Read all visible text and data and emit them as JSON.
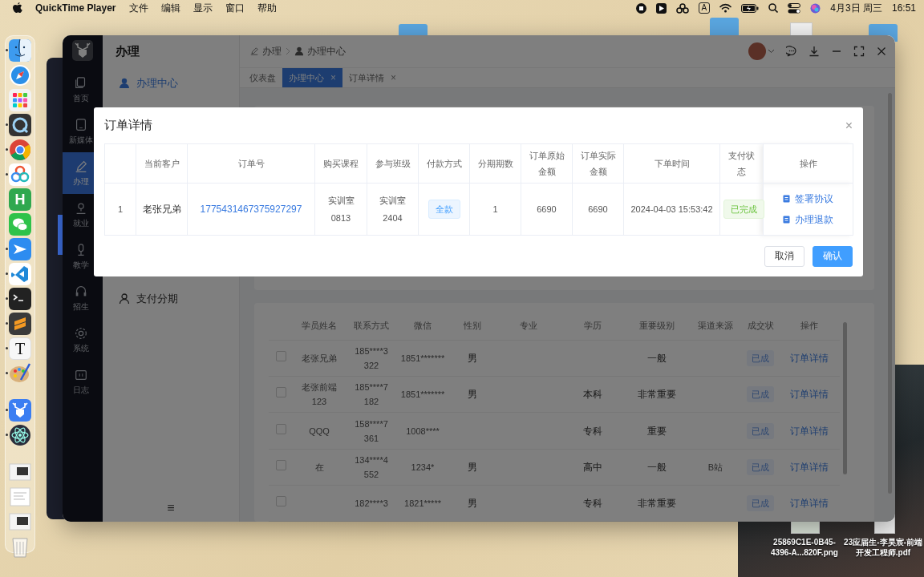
{
  "menubar": {
    "app_name": "QuickTime Player",
    "menus": [
      "文件",
      "编辑",
      "显示",
      "窗口",
      "帮助"
    ],
    "input_method": "A",
    "date": "4月3日 周三",
    "time": "16:51"
  },
  "dock": {
    "apps": [
      {
        "kind": "finder",
        "running": true
      },
      {
        "kind": "safari",
        "running": false
      },
      {
        "kind": "launchpad",
        "running": false
      },
      {
        "kind": "quicktime",
        "running": true
      },
      {
        "kind": "chrome",
        "running": true
      },
      {
        "kind": "cloud",
        "running": true
      },
      {
        "kind": "letter",
        "glyph": "H",
        "running": false
      },
      {
        "kind": "chat",
        "running": false
      },
      {
        "kind": "bird",
        "running": true
      },
      {
        "kind": "code",
        "running": true
      },
      {
        "kind": "terminal",
        "running": true
      },
      {
        "kind": "ribbon",
        "running": true
      },
      {
        "kind": "letter_light",
        "glyph": "T",
        "running": true
      },
      {
        "kind": "palette",
        "running": true
      },
      {
        "kind": "deer",
        "running": true
      },
      {
        "kind": "atom",
        "running": true
      }
    ],
    "minimized": [
      {
        "kind": "window"
      },
      {
        "kind": "document"
      },
      {
        "kind": "window"
      }
    ]
  },
  "desktop_files": [
    {
      "name": "25869C1E-0B45-4396-A...820F.png"
    },
    {
      "name": "23应届生-李昊宸-前端开发工程师.pdf"
    }
  ],
  "app": {
    "sidebar": [
      {
        "label": "首页",
        "selected": false
      },
      {
        "label": "新媒体",
        "selected": false
      },
      {
        "label": "办理",
        "selected": true
      },
      {
        "label": "就业",
        "selected": false
      },
      {
        "label": "教学",
        "selected": false
      },
      {
        "label": "招生",
        "selected": false
      },
      {
        "label": "系统",
        "selected": false
      },
      {
        "label": "日志",
        "selected": false
      }
    ],
    "module_title": "办理",
    "menu": [
      {
        "label": "办理中心",
        "selected": true
      },
      {
        "label": "支付分期",
        "selected": false
      }
    ],
    "menu_toggle": "≡",
    "breadcrumb": [
      "办理",
      "办理中心"
    ],
    "tabs": [
      {
        "label": "仪表盘",
        "selected": false,
        "closable": false
      },
      {
        "label": "办理中心",
        "selected": true,
        "closable": true
      },
      {
        "label": "订单详情",
        "selected": false,
        "closable": true
      }
    ],
    "tab_close": "×",
    "students_table": {
      "columns": [
        "学员姓名",
        "联系方式",
        "微信",
        "性别",
        "专业",
        "学历",
        "重要级别",
        "渠道来源",
        "成交状",
        "操作"
      ],
      "rows": [
        {
          "checked": false,
          "cells": [
            "老张兄弟",
            "185****3322",
            "1851*******",
            "男",
            "",
            "",
            "一般",
            "",
            "已成",
            "订单详情"
          ]
        },
        {
          "checked": false,
          "cells": [
            "老张前端123",
            "185****7182",
            "1851*******",
            "男",
            "",
            "本科",
            "非常重要",
            "",
            "已成",
            "订单详情"
          ]
        },
        {
          "checked": false,
          "cells": [
            "QQQ",
            "158****7361",
            "1008****",
            "",
            "",
            "专科",
            "重要",
            "",
            "已成",
            "订单详情"
          ]
        },
        {
          "checked": false,
          "cells": [
            "在",
            "134****4552",
            "1234*",
            "男",
            "",
            "高中",
            "一般",
            "B站",
            "已成",
            "订单详情"
          ]
        },
        {
          "checked": false,
          "cells": [
            "",
            "182****3",
            "1821*****",
            "男",
            "",
            "专科",
            "非常重要",
            "",
            "已成",
            "订单详情"
          ]
        }
      ]
    }
  },
  "dialog": {
    "title": "订单详情",
    "close": "×",
    "columns": [
      "",
      "当前客户",
      "订单号",
      "购买课程",
      "参与班级",
      "付款方式",
      "分期期数",
      "订单原始金额",
      "订单实际金额",
      "下单时间",
      "支付状态",
      "操作"
    ],
    "rows": [
      {
        "index": "1",
        "customer": "老张兄弟",
        "order_no": "1775431467375927297",
        "course": "实训室0813",
        "class": "实训室2404",
        "payment": "全款",
        "installments": "1",
        "original_amount": "6690",
        "actual_amount": "6690",
        "order_time": "2024-04-03 15:53:42",
        "status": "已完成",
        "actions": [
          "签署协议",
          "办理退款"
        ]
      }
    ],
    "buttons": [
      {
        "label": "取消",
        "primary": false
      },
      {
        "label": "确认",
        "primary": true
      }
    ]
  }
}
